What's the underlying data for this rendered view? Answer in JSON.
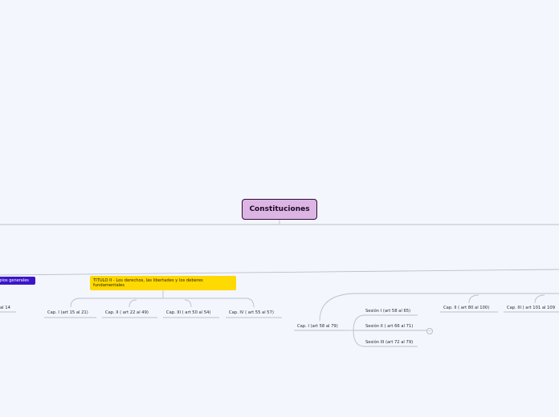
{
  "map": {
    "root": "Constituciones",
    "title_blue": "ipios generales",
    "title_yellow": "TITULO II - Los derechos, las libertades y los deberes fundamentales",
    "leaf_edge": "al 14",
    "cap1": "Cap. I (art 15 al 21)",
    "cap2": "Cap. II ( art 22 al 49)",
    "cap3": "Cap. III ( art 50 al 54)",
    "cap4": "Cap. IV ( art 55 al 57)",
    "cap_i_58": "Cap. I (art 58 al 79)",
    "sesion1": "Sesión I (art 58 al 65)",
    "sesion2": "Sesión II ( art 66 al 71)",
    "sesion3": "Sesión III (art 72 al 79)",
    "cap_ii_80": "Cap. II ( art 80 al 100)",
    "cap_iii_101": "Cap. III ( art 101 al 109",
    "collapse_symbol": "−"
  },
  "colors": {
    "background": "#f4f6fd",
    "root_fill": "#dcb5e3",
    "root_border": "#2b0a3a",
    "title_blue": "#3b16c9",
    "title_yellow": "#ffd902",
    "connector": "#b9bcc9"
  }
}
